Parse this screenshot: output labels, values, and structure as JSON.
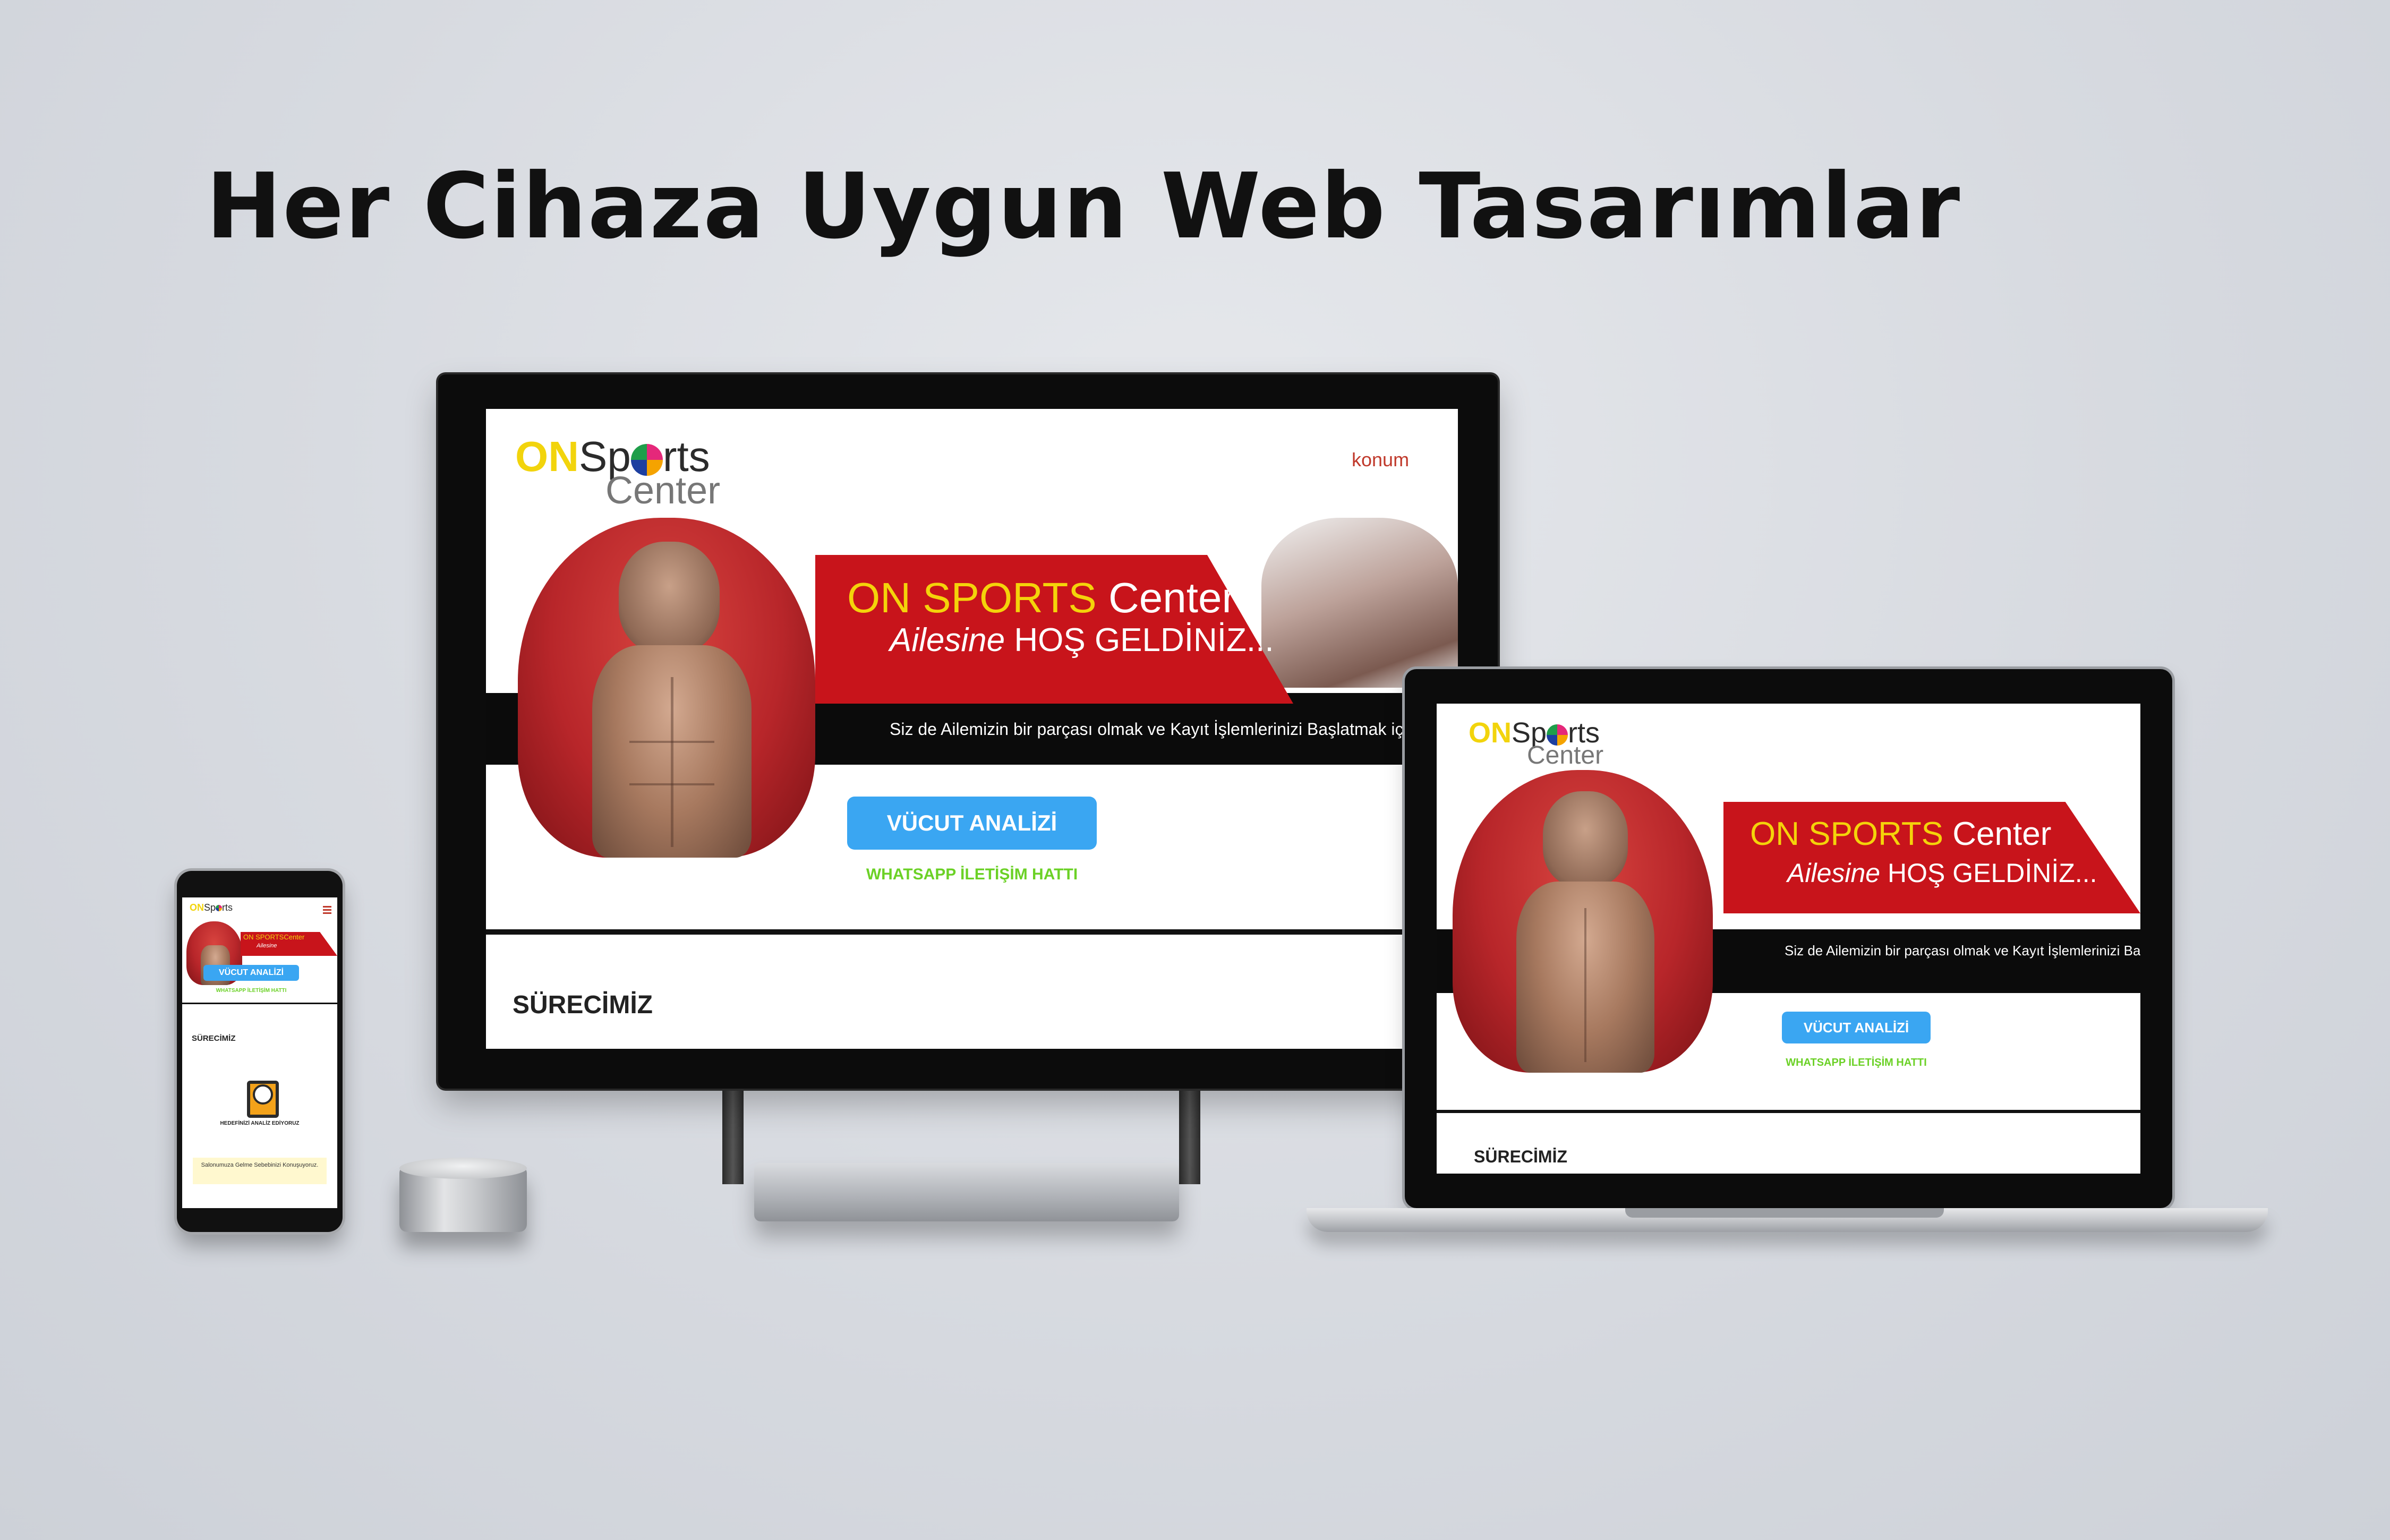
{
  "headline": "Her Cihaza Uygun Web Tasarımlar",
  "site": {
    "logo": {
      "on": "ON",
      "sp": "Sp",
      "rts": "rts",
      "center": "Center"
    },
    "nav": {
      "location": "konum"
    },
    "banner": {
      "line1_yellow": "ON SPORTS",
      "line1_white": "Center",
      "line2_italic": "Ailesine",
      "line2_rest": "HOŞ GELDİNİZ..."
    },
    "band_text": "Siz de Ailemizin bir parçası olmak ve Kayıt İşlemlerinizi Başlatmak için",
    "band_text_laptop": "Siz de Ailemizin bir parçası olmak ve Kayıt İşlemlerinizi Ba",
    "cta_button": "VÜCUT ANALİZİ",
    "whatsapp_link": "WHATSAPP İLETİŞİM HATTI",
    "section_title": "SÜRECİMİZ"
  },
  "phone": {
    "banner_small": "ON SPORTSCenter",
    "banner_small_sub": "Ailesine",
    "step_title": "HEDEFİNİZİ ANALİZ EDİYORUZ",
    "step_text": "Salonumuza Gelme Sebebinizi Konuşuyoruz."
  },
  "colors": {
    "brand_red": "#c8141b",
    "brand_yellow": "#f4d30a",
    "button_blue": "#3aa6f2",
    "whatsapp_green": "#6bd126",
    "nav_red": "#c0392b"
  },
  "icons": [
    "menu-icon",
    "analyze-icon",
    "ball-icon"
  ]
}
